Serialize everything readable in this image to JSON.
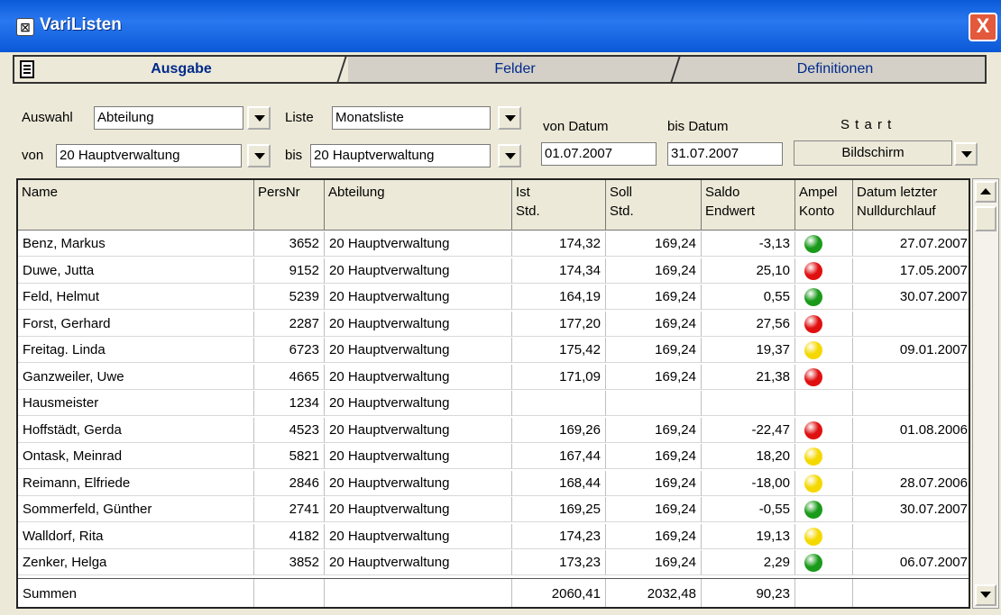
{
  "window": {
    "title": "VariListen",
    "close_label": "X"
  },
  "tabs": [
    {
      "label": "Ausgabe"
    },
    {
      "label": "Felder"
    },
    {
      "label": "Definitionen"
    }
  ],
  "filters": {
    "auswahl_label": "Auswahl",
    "auswahl_value": "Abteilung",
    "liste_label": "Liste",
    "liste_value": "Monatsliste",
    "von_label": "von",
    "von_value": "20  Hauptverwaltung",
    "bis_label": "bis",
    "bis_value": "20  Hauptverwaltung",
    "von_datum_label": "von Datum",
    "von_datum_value": "01.07.2007",
    "bis_datum_label": "bis Datum",
    "bis_datum_value": "31.07.2007",
    "start_label": "S t a r t",
    "start_value": "Bildschirm"
  },
  "colors": {
    "green": "#1a9a1a",
    "red": "#e01010",
    "yellow": "#f5d800"
  },
  "table": {
    "headers": {
      "name": "Name",
      "persnr": "PersNr",
      "abteilung": "Abteilung",
      "ist1": "Ist",
      "ist2": "Std.",
      "soll1": "Soll",
      "soll2": "Std.",
      "saldo1": "Saldo",
      "saldo2": "Endwert",
      "ampel1": "Ampel",
      "ampel2": "Konto",
      "datum1": "Datum letzter",
      "datum2": "Nulldurchlauf"
    },
    "rows": [
      {
        "name": "Benz, Markus",
        "persnr": "3652",
        "abteilung": "20  Hauptverwaltung",
        "ist": "174,32",
        "soll": "169,24",
        "saldo": "-3,13",
        "ampel": "green",
        "datum": "27.07.2007"
      },
      {
        "name": "Duwe, Jutta",
        "persnr": "9152",
        "abteilung": "20  Hauptverwaltung",
        "ist": "174,34",
        "soll": "169,24",
        "saldo": "25,10",
        "ampel": "red",
        "datum": "17.05.2007"
      },
      {
        "name": "Feld, Helmut",
        "persnr": "5239",
        "abteilung": "20  Hauptverwaltung",
        "ist": "164,19",
        "soll": "169,24",
        "saldo": "0,55",
        "ampel": "green",
        "datum": "30.07.2007"
      },
      {
        "name": "Forst, Gerhard",
        "persnr": "2287",
        "abteilung": "20  Hauptverwaltung",
        "ist": "177,20",
        "soll": "169,24",
        "saldo": "27,56",
        "ampel": "red",
        "datum": ""
      },
      {
        "name": "Freitag. Linda",
        "persnr": "6723",
        "abteilung": "20  Hauptverwaltung",
        "ist": "175,42",
        "soll": "169,24",
        "saldo": "19,37",
        "ampel": "yellow",
        "datum": "09.01.2007"
      },
      {
        "name": "Ganzweiler, Uwe",
        "persnr": "4665",
        "abteilung": "20  Hauptverwaltung",
        "ist": "171,09",
        "soll": "169,24",
        "saldo": "21,38",
        "ampel": "red",
        "datum": ""
      },
      {
        "name": "Hausmeister",
        "persnr": "1234",
        "abteilung": "20  Hauptverwaltung",
        "ist": "",
        "soll": "",
        "saldo": "",
        "ampel": "",
        "datum": ""
      },
      {
        "name": "Hoffstädt, Gerda",
        "persnr": "4523",
        "abteilung": "20  Hauptverwaltung",
        "ist": "169,26",
        "soll": "169,24",
        "saldo": "-22,47",
        "ampel": "red",
        "datum": "01.08.2006"
      },
      {
        "name": "Ontask, Meinrad",
        "persnr": "5821",
        "abteilung": "20  Hauptverwaltung",
        "ist": "167,44",
        "soll": "169,24",
        "saldo": "18,20",
        "ampel": "yellow",
        "datum": ""
      },
      {
        "name": "Reimann, Elfriede",
        "persnr": "2846",
        "abteilung": "20  Hauptverwaltung",
        "ist": "168,44",
        "soll": "169,24",
        "saldo": "-18,00",
        "ampel": "yellow",
        "datum": "28.07.2006"
      },
      {
        "name": "Sommerfeld, Günther",
        "persnr": "2741",
        "abteilung": "20  Hauptverwaltung",
        "ist": "169,25",
        "soll": "169,24",
        "saldo": "-0,55",
        "ampel": "green",
        "datum": "30.07.2007"
      },
      {
        "name": "Walldorf, Rita",
        "persnr": "4182",
        "abteilung": "20  Hauptverwaltung",
        "ist": "174,23",
        "soll": "169,24",
        "saldo": "19,13",
        "ampel": "yellow",
        "datum": ""
      },
      {
        "name": "Zenker, Helga",
        "persnr": "3852",
        "abteilung": "20  Hauptverwaltung",
        "ist": "173,23",
        "soll": "169,24",
        "saldo": "2,29",
        "ampel": "green",
        "datum": "06.07.2007"
      }
    ],
    "summen": {
      "label": "Summen",
      "ist": "2060,41",
      "soll": "2032,48",
      "saldo": "90,23"
    }
  }
}
